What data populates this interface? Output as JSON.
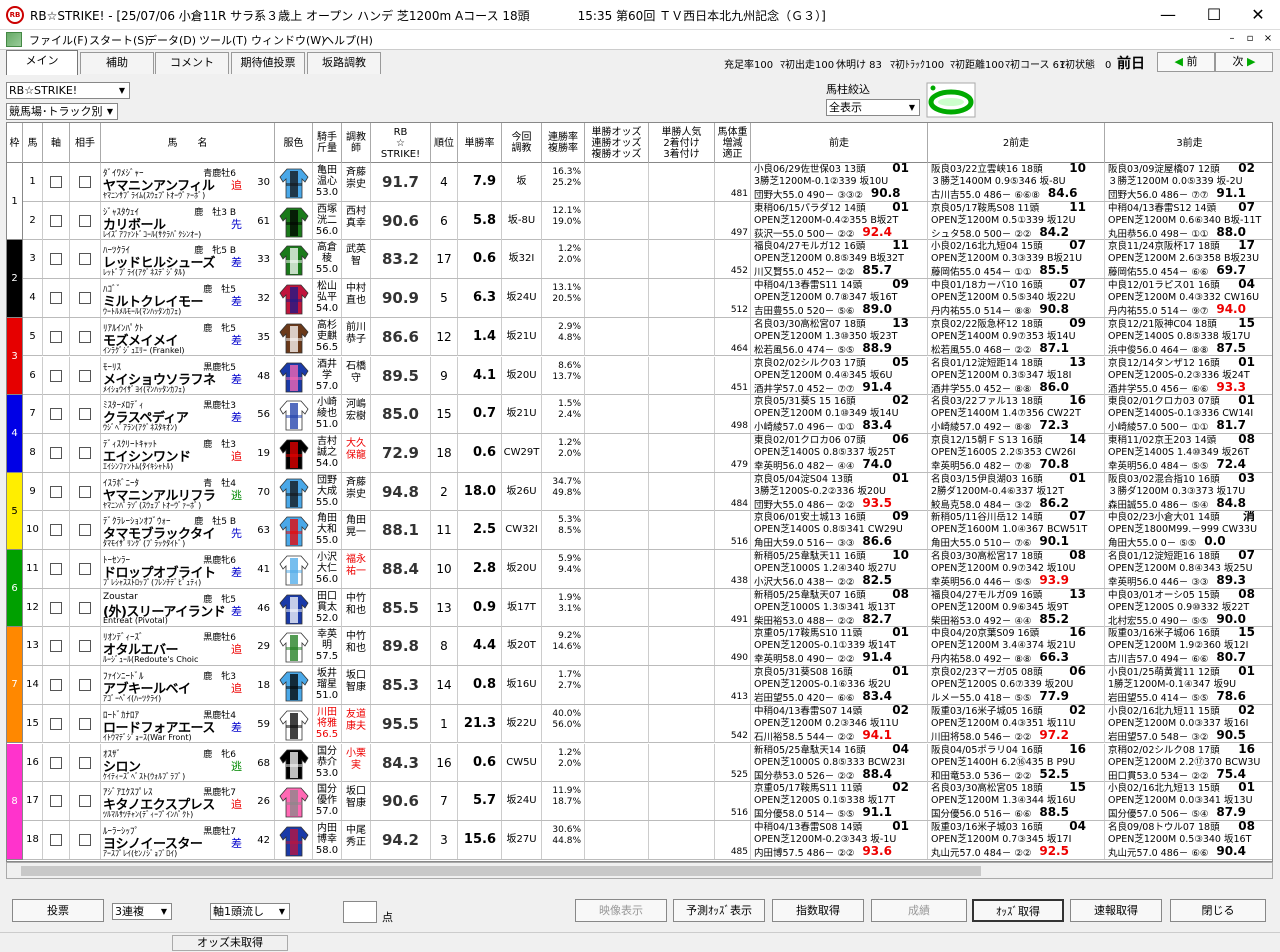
{
  "window": {
    "title": "RB☆STRIKE! - [25/07/06 小倉11R サラ系３歳上 オープン ハンデ 芝1200m Aコース 18頭　　　　15:35 第60回 ＴＶ西日本北九州記念（Ｇ３）]",
    "app_icon": "RB"
  },
  "menu": [
    "ファイル(F)",
    "スタート(S)",
    "データ(D)",
    "ツール(T)",
    "ウィンドウ(W)",
    "ヘルプ(H)"
  ],
  "tabs": [
    "メイン",
    "補助",
    "コメント",
    "期待値投票",
    "坂路調教"
  ],
  "stats": [
    "充足率100",
    "ﾏ初出走100",
    "休明け 83",
    "ﾏ初ﾄﾗｯｸ100",
    "ﾏ初距離100",
    "ﾏ初コース 61",
    "ﾏ初状態　0"
  ],
  "zenjitsu": "前日",
  "nav": {
    "prev": "前",
    "next": "次"
  },
  "filters": {
    "system": "RB☆STRIKE!",
    "sort": "競馬場･トラック別",
    "baba_label": "馬柱絞込",
    "baba_value": "全表示"
  },
  "headers": {
    "waku": "枠",
    "uma": "馬",
    "jiku": "軸",
    "aite": "相手",
    "name": "馬　　名",
    "silk": "服色",
    "jockey": "騎手\n斤量",
    "trainer": "調教\n師",
    "rb": "RB\n☆\nSTRIKE!",
    "rank": "順位",
    "win": "単勝率",
    "train": "今回\n調教",
    "rate": "連勝率\n複勝率",
    "bo1": "単勝オッズ\n連勝オッズ\n複勝オッズ",
    "bo2": "単勝人気\n2着付け\n3着付け",
    "bw": "馬体重\n増減\n適正",
    "p1": "前走",
    "p2": "2前走",
    "p3": "3前走"
  },
  "waku_colors": [
    "#ffffff",
    "#000000",
    "#e60000",
    "#0000e6",
    "#ffee00",
    "#00a000",
    "#ff8800",
    "#ff33cc"
  ],
  "horses": [
    {
      "waku": 1,
      "num": "1",
      "sire": "ﾀﾞｲﾜﾒｼﾞｬｰ",
      "sex": "青鹿牡6",
      "name": "ヤマニンアンフィル",
      "style": "追",
      "styleColor": "red",
      "ninki": "30",
      "dam": "ﾔﾏﾆﾝｻﾌﾞﾗｲﾑ(ｽｳｪﾌﾟﾄｵｰｳﾞｧｰﾎﾞ)",
      "jockey": "亀田\n温心\n53.0",
      "trainer": "斉藤\n崇史",
      "trRed": false,
      "rb": "91.7",
      "rank": "4",
      "win": "7.9",
      "train": "坂",
      "rate": "16.3%\n25.2%",
      "bw": "481",
      "silk": [
        "#4aa8e8",
        "#111"
      ],
      "p1": [
        "小良06/29佐世保03 13頭",
        "3勝芝1200M-0.1②339 坂10U",
        "団野大55.0 490－ ③③②"
      ],
      "p1r": "01",
      "p1p": "90.8",
      "p1red": false,
      "p2": [
        "阪良03/22立雲峡16 18頭",
        "３勝芝1400M 0.9⑤346 坂-8U",
        "古川吉55.0 486－ ⑥⑥⑧"
      ],
      "p2r": "10",
      "p2p": "84.6",
      "p2red": false,
      "p3": [
        "阪良03/09淀屋橋07 12頭",
        "３勝芝1200M 0.0⑤339 坂-2U",
        "団野大56.0 486－ ⑦⑦"
      ],
      "p3r": "02",
      "p3p": "91.1",
      "p3red": false
    },
    {
      "waku": 1,
      "num": "2",
      "sire": "ｼﾞｬｽﾀｳｪｲ",
      "sex": "鹿　牡3 B",
      "name": "カリボール",
      "style": "先",
      "styleColor": "blue",
      "ninki": "61",
      "dam": "ﾚｲｽﾞｱﾌｧﾝﾄﾞｺｰﾙ(ｻｸﾗﾊﾞｸｼﾝｵｰ)",
      "jockey": "西塚\n洸二\n56.0",
      "trainer": "西村\n真幸",
      "trRed": false,
      "rb": "90.6",
      "rank": "6",
      "win": "5.8",
      "train": "坂-8U",
      "rate": "12.1%\n19.0%",
      "bw": "497",
      "silk": [
        "#1a7a1a",
        "#000"
      ],
      "p1": [
        "東稍06/15パラダ12 14頭",
        "OPEN芝1200M-0.4②355 B坂2T",
        "荻沢一55.0 500－ ②②"
      ],
      "p1r": "01",
      "p1p": "92.4",
      "p1red": true,
      "p2": [
        "京良05/17鞍馬S08 11頭",
        "OPEN芝1200M 0.5①339 坂12U",
        "シュタ58.0 500－ ②②"
      ],
      "p2r": "11",
      "p2p": "84.2",
      "p2red": false,
      "p3": [
        "中稍04/13春雷S12 14頭",
        "OPEN芝1200M 0.6⑥340 B坂-11T",
        "丸田恭56.0 498－ ①①"
      ],
      "p3r": "07",
      "p3p": "88.0",
      "p3red": false
    },
    {
      "waku": 2,
      "num": "3",
      "sire": "ﾊｰﾂｸﾗｲ",
      "sex": "鹿　牝5 B",
      "name": "レッドヒルシューズ",
      "style": "差",
      "styleColor": "blue",
      "ninki": "33",
      "dam": "ﾚｯﾄﾞﾌﾞﾗｲ(ｱｸﾞﾈｽﾃﾞｼﾞﾀﾙ)",
      "jockey": "高倉\n稜\n55.0",
      "trainer": "武英\n智",
      "trRed": false,
      "rb": "83.2",
      "rank": "17",
      "win": "0.6",
      "train": "坂32I",
      "rate": "1.2%\n2.0%",
      "bw": "452",
      "silk": [
        "#1a7a1a",
        "#fff"
      ],
      "p1": [
        "福良04/27モルガ12 16頭",
        "OPEN芝1200M 0.8⑤349 B坂32T",
        "川又賢55.0 452－ ②②"
      ],
      "p1r": "11",
      "p1p": "85.7",
      "p1red": false,
      "p2": [
        "小良02/16北九短04 15頭",
        "OPEN芝1200M 0.3③339 B坂21U",
        "藤岡佑55.0 454－ ①①"
      ],
      "p2r": "07",
      "p2p": "85.5",
      "p2red": false,
      "p3": [
        "京良11/24京阪杯17 18頭",
        "OPEN芝1200M 2.6③358 B坂23U",
        "藤岡佑55.0 454－ ⑥⑥"
      ],
      "p3r": "17",
      "p3p": "69.7",
      "p3red": false
    },
    {
      "waku": 2,
      "num": "4",
      "sire": "ﾊｺﾞﾞ",
      "sex": "鹿　牡5",
      "name": "ミルトクレイモー",
      "style": "差",
      "styleColor": "blue",
      "ninki": "32",
      "dam": "ｳｰﾄﾙﾒﾙﾓｰﾙ(ﾏﾝﾊｯﾀﾝｶﾌｪ)",
      "jockey": "松山\n弘平\n54.0",
      "trainer": "中村\n直也",
      "trRed": false,
      "rb": "90.9",
      "rank": "5",
      "win": "6.3",
      "train": "坂24U",
      "rate": "13.1%\n20.5%",
      "bw": "512",
      "silk": [
        "#c0143c",
        "#1a1a8a"
      ],
      "p1": [
        "中稍04/13春雷S11 14頭",
        "OPEN芝1200M 0.7⑧347 坂16T",
        "吉田豊55.0 520－ ⑤⑥"
      ],
      "p1r": "09",
      "p1p": "89.0",
      "p1red": false,
      "p2": [
        "中良01/18カーバ10 16頭",
        "OPEN芝1200M 0.5⑤340 坂22U",
        "丹内祐55.0 514－ ⑧⑧"
      ],
      "p2r": "07",
      "p2p": "90.8",
      "p2red": false,
      "p3": [
        "中良12/01ラピス01 16頭",
        "OPEN芝1200M 0.4③332 CW16U",
        "丹内祐55.0 514－ ⑨⑦"
      ],
      "p3r": "04",
      "p3p": "94.0",
      "p3red": true
    },
    {
      "waku": 3,
      "num": "5",
      "sire": "ﾘｱﾙｲﾝﾊﾟｸﾄ",
      "sex": "鹿　牝5",
      "name": "モズメイメイ",
      "style": "差",
      "styleColor": "blue",
      "ninki": "35",
      "dam": "ｲﾝﾗｸﾞｼﾞｭｴﾘｰ (Frankel)",
      "jockey": "高杉\n吏麒\n56.5",
      "trainer": "前川\n恭子",
      "trRed": false,
      "rb": "86.6",
      "rank": "12",
      "win": "1.4",
      "train": "坂21U",
      "rate": "2.9%\n4.8%",
      "bw": "464",
      "silk": [
        "#6b3a1a",
        "#fff"
      ],
      "p1": [
        "名良03/30高松宮07 18頭",
        "OPEN芝1200M 1.3⑩350 坂23T",
        "松若風56.0 474－ ⑤⑤"
      ],
      "p1r": "13",
      "p1p": "88.9",
      "p1red": false,
      "p2": [
        "京良02/22阪急杯12 18頭",
        "OPEN芝1400M 0.9⑦353 坂14U",
        "松若風55.0 468－ ②②"
      ],
      "p2r": "09",
      "p2p": "87.1",
      "p2red": false,
      "p3": [
        "京良12/21阪神C04 18頭",
        "OPEN芝1400S 0.8⑤338 坂17U",
        "浜中俊56.0 464－ ⑧⑧"
      ],
      "p3r": "15",
      "p3p": "87.5",
      "p3red": false
    },
    {
      "waku": 3,
      "num": "6",
      "sire": "ﾓｰﾘｽ",
      "sex": "黒鹿牝5",
      "name": "メイショウソラフネ",
      "style": "差",
      "styleColor": "blue",
      "ninki": "48",
      "dam": "ﾒｲｼｮｳｲｻﾞﾖｲ(ﾏﾝﾊｯﾀﾝｶﾌｪ)",
      "jockey": "酒井\n学\n57.0",
      "trainer": "石橋\n守",
      "trRed": false,
      "rb": "89.5",
      "rank": "9",
      "win": "4.1",
      "train": "坂20U",
      "rate": "8.6%\n13.7%",
      "bw": "451",
      "silk": [
        "#1a3aa8",
        "#ff69b4"
      ],
      "p1": [
        "京良02/02シルク03 17頭",
        "OPEN芝1200M 0.4④345 坂6U",
        "酒井学57.0 452－ ⑦⑦"
      ],
      "p1r": "05",
      "p1p": "91.4",
      "p1red": false,
      "p2": [
        "名良01/12淀短距14 18頭",
        "OPEN芝1200M 0.3⑤347 坂18I",
        "酒井学55.0 452－ ⑧⑧"
      ],
      "p2r": "13",
      "p2p": "86.0",
      "p2red": false,
      "p3": [
        "京良12/14タンザ12 16頭",
        "OPEN芝1200S-0.2③336 坂24T",
        "酒井学55.0 456－ ⑥⑥"
      ],
      "p3r": "01",
      "p3p": "93.3",
      "p3red": true
    },
    {
      "waku": 4,
      "num": "7",
      "sire": "ﾐｽﾀｰﾒﾛﾃﾞｨ",
      "sex": "黒鹿牡3",
      "name": "クラスペディア",
      "style": "差",
      "styleColor": "blue",
      "ninki": "56",
      "dam": "ｳｼﾞﾍﾞｱﾗﾝ(ｱｸﾞﾈｽﾀｷｵﾝ)",
      "jockey": "小崎\n綾也\n51.0",
      "trainer": "河嶋\n宏樹",
      "trRed": false,
      "rb": "85.0",
      "rank": "15",
      "win": "0.7",
      "train": "坂21U",
      "rate": "1.5%\n2.4%",
      "bw": "498",
      "silk": [
        "#fff",
        "#1a3aa8"
      ],
      "p1": [
        "京良05/31葵S 15 16頭",
        "OPEN芝1200M 0.1⑩349 坂14U",
        "小崎綾57.0 496－ ①①"
      ],
      "p1r": "02",
      "p1p": "83.4",
      "p1red": false,
      "p2": [
        "名良03/22ファル13 18頭",
        "OPEN芝1400M 1.4⑦356 CW22T",
        "小崎綾57.0 492－ ⑧⑧"
      ],
      "p2r": "16",
      "p2p": "72.3",
      "p2red": false,
      "p3": [
        "東良02/01クロカ03 07頭",
        "OPEN芝1400S-0.1③336 CW14I",
        "小崎綾57.0 500－ ①①"
      ],
      "p3r": "01",
      "p3p": "81.7",
      "p3red": false
    },
    {
      "waku": 4,
      "num": "8",
      "sire": "ﾃﾞｨｽｸﾘｰﾄｷｬｯﾄ",
      "sex": "鹿　牡3",
      "name": "エイシンワンド",
      "style": "追",
      "styleColor": "red",
      "ninki": "19",
      "dam": "ｴｲｼﾝﾌｧﾝﾄﾑ(ﾀｲｷｼｬﾄﾙ)",
      "jockey": "吉村\n誠之\n54.0",
      "trainer": "大久\n保龍",
      "trRed": true,
      "rb": "72.9",
      "rank": "18",
      "win": "0.6",
      "train": "CW29T",
      "rate": "1.2%\n2.0%",
      "bw": "479",
      "silk": [
        "#000",
        "#e00"
      ],
      "p1": [
        "東良02/01クロカ06 07頭",
        "OPEN芝1400S 0.8⑤337 坂25T",
        "幸英明56.0 482－ ④④"
      ],
      "p1r": "06",
      "p1p": "74.0",
      "p1red": false,
      "p2": [
        "京良12/15朝ＦＳ13 16頭",
        "OPEN芝1600S 2.2⑤353 CW26I",
        "幸英明56.0 482－ ⑦⑧"
      ],
      "p2r": "14",
      "p2p": "70.8",
      "p2red": false,
      "p3": [
        "東稍11/02京王203 14頭",
        "OPEN芝1400S 1.4⑩349 坂26T",
        "幸英明56.0 484－ ⑤⑤"
      ],
      "p3r": "08",
      "p3p": "72.4",
      "p3red": false
    },
    {
      "waku": 5,
      "num": "9",
      "sire": "ｲｽﾗﾎﾞﾆｰﾀ",
      "sex": "青　牡4",
      "name": "ヤマニンアルリフラ",
      "style": "逃",
      "styleColor": "green",
      "ninki": "70",
      "dam": "ﾔﾏﾆﾝﾊﾟﾗｿﾞ(ｽｳｪﾌﾟﾄｵｰｳﾞｧｰﾎﾞ)",
      "jockey": "団野\n大成\n55.0",
      "trainer": "斉藤\n崇史",
      "trRed": false,
      "rb": "94.8",
      "rank": "2",
      "win": "18.0",
      "train": "坂26U",
      "rate": "34.7%\n49.8%",
      "bw": "484",
      "silk": [
        "#4aa8e8",
        "#111"
      ],
      "p1": [
        "京良05/04淀S04 13頭",
        "3勝芝1200S-0.2②336 坂20U",
        "団野大55.0 486－ ②②"
      ],
      "p1r": "01",
      "p1p": "93.5",
      "p1red": true,
      "p2": [
        "名良03/15伊良湖03 16頭",
        "2勝ダ1200M-0.4⑥337 坂12T",
        "鮫島克58.0 484－ ③②"
      ],
      "p2r": "01",
      "p2p": "86.2",
      "p2red": false,
      "p3": [
        "阪良03/02混合指10 16頭",
        "３勝ダ1200M 0.3③373 坂17U",
        "森田誠55.0 486－ ⑤④"
      ],
      "p3r": "03",
      "p3p": "84.8",
      "p3red": false
    },
    {
      "waku": 5,
      "num": "10",
      "sire": "ﾃﾞｸﾗﾚｰｼｮﾝｵﾌﾞｳｫｰ",
      "sex": "鹿　牡5 B",
      "name": "タマモブラックタイ",
      "style": "先",
      "styleColor": "blue",
      "ninki": "63",
      "dam": "ﾀﾏﾓｲｻﾞﾘﾝｸﾞ(ﾌﾞﾗｯｸﾀｲﾄﾞ)",
      "jockey": "角田\n大和\n55.0",
      "trainer": "角田\n晃一",
      "trRed": false,
      "rb": "88.1",
      "rank": "11",
      "win": "2.5",
      "train": "CW32I",
      "rate": "5.3%\n8.5%",
      "bw": "516",
      "silk": [
        "#4aa8e8",
        "#e00"
      ],
      "p1": [
        "京良06/01安土城13 16頭",
        "OPEN芝1400S 0.8⑤341 CW29U",
        "角田大59.0 516－ ③③"
      ],
      "p1r": "09",
      "p1p": "86.6",
      "p1red": false,
      "p2": [
        "新稍05/11谷川岳12 14頭",
        "OPEN芝1600M 1.0④367 BCW51T",
        "角田大55.0 510－ ⑦⑥"
      ],
      "p2r": "07",
      "p2p": "90.1",
      "p2red": false,
      "p3": [
        "中良02/23小倉大01 14頭",
        "OPEN芝1800M99.－999 CW33U",
        "角田大55.0 0－ ⑤⑤"
      ],
      "p3r": "消",
      "p3p": "0.0",
      "p3red": false
    },
    {
      "waku": 6,
      "num": "11",
      "sire": "ﾄｰｾﾝﾗｰ",
      "sex": "黒鹿牝6",
      "name": "ドロップオブライト",
      "style": "差",
      "styleColor": "blue",
      "ninki": "41",
      "dam": "ﾌﾟﾚｼｬｽｽﾄﾛｯﾌﾟ(ﾌﾚﾝﾁﾃﾞﾋﾟｭﾃｨ)",
      "jockey": "小沢\n大仁\n56.0",
      "trainer": "福永\n祐一",
      "trRed": true,
      "rb": "88.4",
      "rank": "10",
      "win": "2.8",
      "train": "坂20U",
      "rate": "5.9%\n9.4%",
      "bw": "438",
      "silk": [
        "#fff",
        "#4aa8e8"
      ],
      "p1": [
        "新稍05/25韋駄天11 16頭",
        "OPEN芝1000S 1.2④340 坂27U",
        "小沢大56.0 438－ ②②"
      ],
      "p1r": "10",
      "p1p": "82.5",
      "p1red": false,
      "p2": [
        "名良03/30高松宮17 18頭",
        "OPEN芝1200M 0.9⑦342 坂10U",
        "幸英明56.0 446－ ⑤⑤"
      ],
      "p2r": "08",
      "p2p": "93.9",
      "p2red": true,
      "p3": [
        "名良01/12淀短距16 18頭",
        "OPEN芝1200M 0.8④343 坂25U",
        "幸英明56.0 446－ ③③"
      ],
      "p3r": "07",
      "p3p": "89.3",
      "p3red": false
    },
    {
      "waku": 6,
      "num": "12",
      "sire": "Zoustar",
      "sex": "鹿　牝5",
      "name": "(外)スリーアイランド",
      "style": "差",
      "styleColor": "blue",
      "ninki": "46",
      "dam": "Entreat (Pivotal)",
      "jockey": "田口\n貫太\n52.0",
      "trainer": "中竹\n和也",
      "trRed": false,
      "rb": "85.5",
      "rank": "13",
      "win": "0.9",
      "train": "坂17T",
      "rate": "1.9%\n3.1%",
      "bw": "491",
      "silk": [
        "#1a3aa8",
        "#fff"
      ],
      "p1": [
        "新稍05/25韋駄天07 16頭",
        "OPEN芝1000S 1.3⑤341 坂13T",
        "柴田裕53.0 488－ ②②"
      ],
      "p1r": "08",
      "p1p": "82.7",
      "p1red": false,
      "p2": [
        "福良04/27モルガ09 16頭",
        "OPEN芝1200M 0.9⑥345 坂9T",
        "柴田裕53.0 492－ ④④"
      ],
      "p2r": "13",
      "p2p": "85.2",
      "p2red": false,
      "p3": [
        "中良03/01オーシ05 15頭",
        "OPEN芝1200S 0.9⑩332 坂22T",
        "北村宏55.0 490－ ⑤⑤"
      ],
      "p3r": "08",
      "p3p": "90.0",
      "p3red": false
    },
    {
      "waku": 7,
      "num": "13",
      "sire": "ﾘｵﾝﾃﾞｨｰｽﾞ",
      "sex": "黒鹿牡6",
      "name": "オタルエバー",
      "style": "追",
      "styleColor": "red",
      "ninki": "29",
      "dam": "ﾙｰｼﾞｭｰﾙ(Redoute's Choic",
      "jockey": "幸英\n明\n57.5",
      "trainer": "中竹\n和也",
      "trRed": false,
      "rb": "89.8",
      "rank": "8",
      "win": "4.4",
      "train": "坂20T",
      "rate": "9.2%\n14.6%",
      "bw": "490",
      "silk": [
        "#fff",
        "#1a7a1a"
      ],
      "p1": [
        "京重05/17鞍馬S10 11頭",
        "OPEN芝1200S-0.1①339 坂14T",
        "幸英明58.0 490－ ②②"
      ],
      "p1r": "01",
      "p1p": "91.4",
      "p1red": false,
      "p2": [
        "中良04/20京葉S09 16頭",
        "OPEN芝1200M 3.4④374 坂21U",
        "丹内祐58.0 492－ ⑧⑧"
      ],
      "p2r": "16",
      "p2p": "66.3",
      "p2red": false,
      "p3": [
        "阪重03/16米子城06 16頭",
        "OPEN芝1200M 1.9②360 坂12I",
        "古川吉57.0 494－ ⑥⑥"
      ],
      "p3r": "15",
      "p3p": "80.7",
      "p3red": false
    },
    {
      "waku": 7,
      "num": "14",
      "sire": "ﾌｧｲﾝﾆｰﾄﾞﾙ",
      "sex": "鹿　牝3",
      "name": "アブキールベイ",
      "style": "追",
      "styleColor": "red",
      "ninki": "18",
      "dam": "ｱｺﾞｰﾍﾟｲ(ﾊｰﾂｸﾗｲ)",
      "jockey": "坂井\n瑠星\n51.0",
      "trainer": "坂口\n智康",
      "trRed": false,
      "rb": "85.3",
      "rank": "14",
      "win": "0.8",
      "train": "坂16U",
      "rate": "1.7%\n2.7%",
      "bw": "413",
      "silk": [
        "#4aa8e8",
        "#000"
      ],
      "p1": [
        "京良05/31葵S08 16頭",
        "OPEN芝1200S-0.1⑥336 坂2U",
        "岩田望55.0 420－ ⑥⑥"
      ],
      "p1r": "01",
      "p1p": "83.4",
      "p1red": false,
      "p2": [
        "京良02/23マーガ05 08頭",
        "OPEN芝1200S 0.6⑦339 坂20U",
        "ルメー55.0 418－ ⑤⑤"
      ],
      "p2r": "06",
      "p2p": "77.9",
      "p2red": false,
      "p3": [
        "小良01/25萌黄賞11 12頭",
        "1勝芝1200M-0.1④347 坂9U",
        "岩田望55.0 414－ ⑤⑤"
      ],
      "p3r": "01",
      "p3p": "78.6",
      "p3red": false
    },
    {
      "waku": 7,
      "num": "15",
      "sire": "ﾛｰﾄﾞｶﾅﾛｱ",
      "sex": "黒鹿牡4",
      "name": "ロードフォアエース",
      "style": "差",
      "styleColor": "blue",
      "ninki": "59",
      "dam": "ｲﾄｳﾏﾃﾞｼﾞｮｰｽ(War Front)",
      "jockey": "川田\n将雅\n56.5",
      "trainer": "友道\n康夫",
      "trRed": true,
      "rb": "95.5",
      "rank": "1",
      "win": "21.3",
      "train": "坂22U",
      "rate": "40.0%\n56.0%",
      "bw": "542",
      "silk": [
        "#fff",
        "#000"
      ],
      "jRed": true,
      "p1": [
        "中稍04/13春雷S07 14頭",
        "OPEN芝1200M 0.2③346 坂11U",
        "石川裕58.5 544－ ②②"
      ],
      "p1r": "02",
      "p1p": "94.1",
      "p1red": true,
      "p2": [
        "阪重03/16米子城05 16頭",
        "OPEN芝1200M 0.4③351 坂11U",
        "川田将58.0 546－ ②②"
      ],
      "p2r": "02",
      "p2p": "97.2",
      "p2red": true,
      "p3": [
        "小良02/16北九短11 15頭",
        "OPEN芝1200M 0.0③337 坂16I",
        "岩田望57.0 548－ ③②"
      ],
      "p3r": "02",
      "p3p": "90.5",
      "p3red": false
    },
    {
      "waku": 8,
      "num": "16",
      "sire": "ｵｽｻﾞ",
      "sex": "鹿　牝6",
      "name": "シロン",
      "style": "逃",
      "styleColor": "green",
      "ninki": "68",
      "dam": "ｹｲﾃｨｰｽﾞﾍﾞｽﾄ(ｳｫﾙﾌﾞﾗﾌﾞ)",
      "jockey": "国分\n恭介\n53.0",
      "trainer": "小栗\n実",
      "trRed": true,
      "rb": "84.3",
      "rank": "16",
      "win": "0.6",
      "train": "CW5U",
      "rate": "1.2%\n2.0%",
      "bw": "525",
      "silk": [
        "#000",
        "#fff"
      ],
      "p1": [
        "新稍05/25韋駄天14 16頭",
        "OPEN芝1000S 0.8⑤333 BCW23I",
        "国分恭53.0 526－ ②②"
      ],
      "p1r": "04",
      "p1p": "88.4",
      "p1red": false,
      "p2": [
        "阪良04/05ポラリ04 16頭",
        "OPEN芝1400H 6.2⑯435 B P9U",
        "和田竜53.0 536－ ②②"
      ],
      "p2r": "16",
      "p2p": "52.5",
      "p2red": false,
      "p3": [
        "京稍02/02シルク08 17頭",
        "OPEN芝1200M 2.2⑰370 BCW3U",
        "田口貫53.0 534－ ②②"
      ],
      "p3r": "16",
      "p3p": "75.4",
      "p3red": false
    },
    {
      "waku": 8,
      "num": "17",
      "sire": "ｱｼﾞｱｴｸｽﾌﾟﾚｽ",
      "sex": "黒鹿牝7",
      "name": "キタノエクスプレス",
      "style": "追",
      "styleColor": "red",
      "ninki": "26",
      "dam": "ﾂﾙﾏﾙｻﾂﾁｬﾝ(ﾃﾞｨｰﾌﾟｲﾝﾊﾟｸﾄ)",
      "jockey": "国分\n優作\n57.0",
      "trainer": "坂口\n智康",
      "trRed": false,
      "rb": "90.6",
      "rank": "7",
      "win": "5.7",
      "train": "坂24U",
      "rate": "11.9%\n18.7%",
      "bw": "516",
      "silk": [
        "#ff69b4",
        "#888"
      ],
      "p1": [
        "京重05/17鞍馬S11 11頭",
        "OPEN芝1200S 0.1⑤338 坂17T",
        "国分優58.0 514－ ⑤⑤"
      ],
      "p1r": "02",
      "p1p": "91.1",
      "p1red": false,
      "p2": [
        "名良03/30高松宮05 18頭",
        "OPEN芝1200M 1.3④344 坂16U",
        "国分優56.0 516－ ⑥⑥"
      ],
      "p2r": "15",
      "p2p": "88.5",
      "p2red": false,
      "p3": [
        "小良02/16北九短13 15頭",
        "OPEN芝1200M 0.0③341 坂13U",
        "国分優57.0 506－ ⑤④"
      ],
      "p3r": "01",
      "p3p": "87.9",
      "p3red": false
    },
    {
      "waku": 8,
      "num": "18",
      "sire": "ﾙｰﾗｰｼｯﾌﾟ",
      "sex": "黒鹿牡7",
      "name": "ヨシノイースター",
      "style": "差",
      "styleColor": "blue",
      "ninki": "42",
      "dam": "ｱｰｽﾌﾟﾚｲ(ｾﾝﾉｼﾞｮﾌﾞﾛｲ)",
      "jockey": "内田\n博幸\n58.0",
      "trainer": "中尾\n秀正",
      "trRed": false,
      "rb": "94.2",
      "rank": "3",
      "win": "15.6",
      "train": "坂27U",
      "rate": "30.6%\n44.8%",
      "bw": "485",
      "silk": [
        "#1a3aa8",
        "#c0143c"
      ],
      "p1": [
        "中稍04/13春雷S08 14頭",
        "OPEN芝1200M-0.2③343 坂-1U",
        "内田博57.5 486－ ②②"
      ],
      "p1r": "01",
      "p1p": "93.6",
      "p1red": true,
      "p2": [
        "阪重03/16米子城03 16頭",
        "OPEN芝1200M 0.7③345 坂17I",
        "丸山元57.0 484－ ②②"
      ],
      "p2r": "04",
      "p2p": "92.5",
      "p2red": true,
      "p3": [
        "名良09/08トウル07 18頭",
        "OPEN芝1200M 0.5③340 坂16T",
        "丸山元57.0 486－ ⑥⑥"
      ],
      "p3r": "08",
      "p3p": "90.4",
      "p3red": false
    }
  ],
  "bottom": {
    "vote": "投票",
    "bet_type": "3連複",
    "flow": "軸1頭流し",
    "points_label": "点",
    "video": "映像表示",
    "predict": "予測ｵｯｽﾞ表示",
    "index": "指数取得",
    "result": "成績",
    "odds": "ｵｯｽﾞ取得",
    "speed": "速報取得",
    "close": "閉じる"
  },
  "status": "オッズ未取得"
}
